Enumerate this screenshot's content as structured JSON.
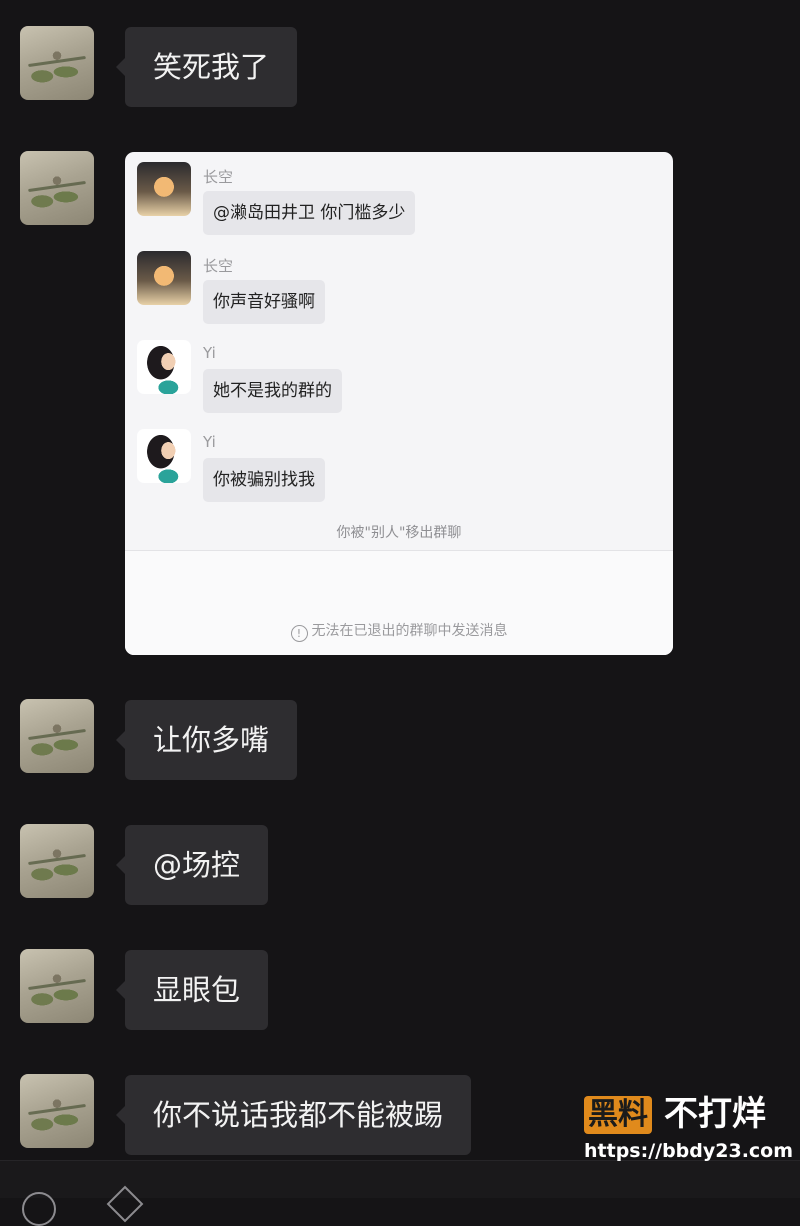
{
  "messages": [
    {
      "text": "笑死我了"
    },
    {
      "text": "让你多嘴"
    },
    {
      "text": "@场控"
    },
    {
      "text": "显眼包"
    },
    {
      "text": "你不说话我都不能被踢"
    }
  ],
  "screenshot": {
    "chat": [
      {
        "sender": "长空",
        "avatar": "cat-avatar",
        "text": "@濑岛田井卫 你门槛多少"
      },
      {
        "sender": "长空",
        "avatar": "cat-avatar",
        "text": "你声音好骚啊"
      },
      {
        "sender": "Yi",
        "avatar": "girl-avatar",
        "text": "她不是我的群的"
      },
      {
        "sender": "Yi",
        "avatar": "girl-avatar",
        "text": "你被骗别找我"
      }
    ],
    "system_notice": "你被\"别人\"移出群聊",
    "input_notice": "无法在已退出的群聊中发送消息",
    "input_notice_icon": "!"
  },
  "watermark": {
    "logo": "黑料",
    "title": "不打烊",
    "url": "https://bbdy23.com",
    "logo_color": "#e08a1c"
  }
}
